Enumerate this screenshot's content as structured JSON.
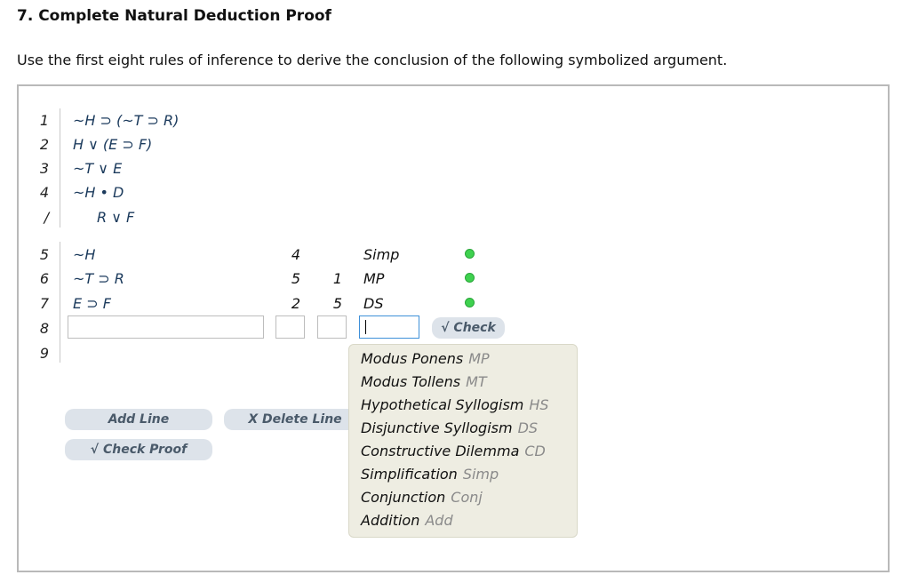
{
  "header": {
    "title": "7. Complete Natural Deduction Proof",
    "instructions": "Use the first eight rules of inference to derive the conclusion of the following symbolized argument."
  },
  "premises": [
    {
      "num": "1",
      "formula": "~H ⊃ (~T ⊃ R)"
    },
    {
      "num": "2",
      "formula": "H ∨ (E ⊃ F)"
    },
    {
      "num": "3",
      "formula": "~T ∨ E"
    },
    {
      "num": "4",
      "formula": "~H • D"
    }
  ],
  "conclusion": {
    "num": "/",
    "formula": "R ∨ F"
  },
  "steps": [
    {
      "num": "5",
      "formula": "~H",
      "cite1": "4",
      "cite2": "",
      "rule": "Simp"
    },
    {
      "num": "6",
      "formula": "~T ⊃ R",
      "cite1": "5",
      "cite2": "1",
      "rule": "MP"
    },
    {
      "num": "7",
      "formula": "E ⊃ F",
      "cite1": "2",
      "cite2": "5",
      "rule": "DS"
    }
  ],
  "input_line": {
    "num": "8",
    "formula_value": "",
    "cite1_value": "",
    "cite2_value": "",
    "rule_value": ""
  },
  "empty_line": {
    "num": "9"
  },
  "buttons": {
    "check": "√ Check",
    "add_line": "Add Line",
    "delete_line": "X  Delete Line",
    "check_proof": "√  Check Proof"
  },
  "rules_menu": [
    {
      "name": "Modus Ponens",
      "abbr": "MP"
    },
    {
      "name": "Modus Tollens",
      "abbr": "MT"
    },
    {
      "name": "Hypothetical Syllogism",
      "abbr": "HS"
    },
    {
      "name": "Disjunctive Syllogism",
      "abbr": "DS"
    },
    {
      "name": "Constructive Dilemma",
      "abbr": "CD"
    },
    {
      "name": "Simplification",
      "abbr": "Simp"
    },
    {
      "name": "Conjunction",
      "abbr": "Conj"
    },
    {
      "name": "Addition",
      "abbr": "Add"
    }
  ],
  "colors": {
    "valid_dot": "#3fd14f",
    "focus_border": "#3e90d9",
    "menu_bg": "#eeede2"
  }
}
